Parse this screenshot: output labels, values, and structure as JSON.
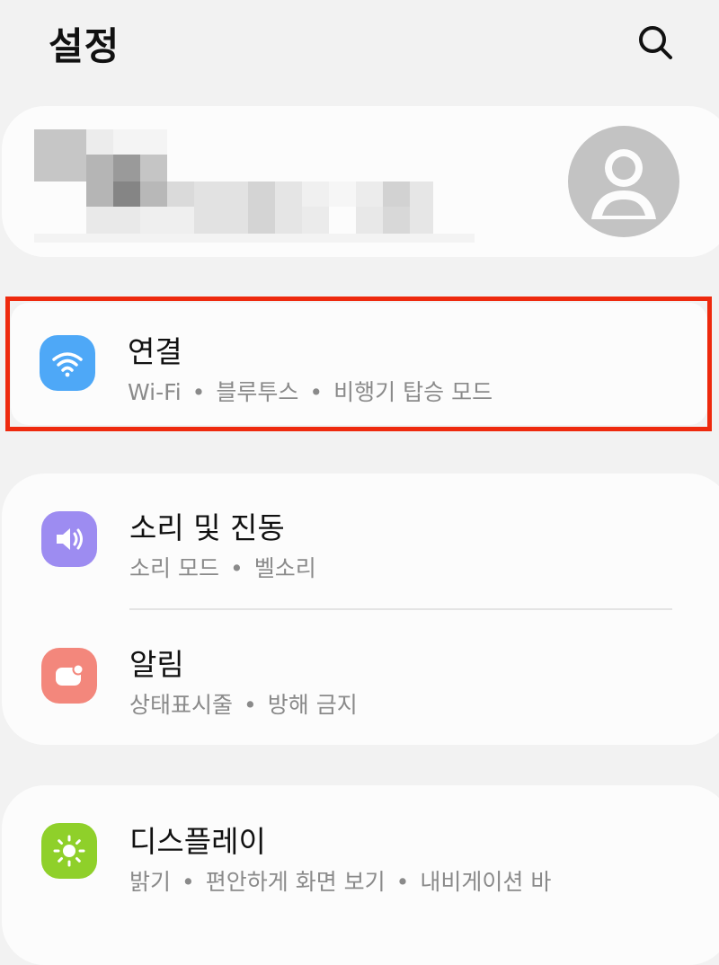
{
  "header": {
    "title": "설정",
    "search_icon": "search-icon"
  },
  "profile": {
    "avatar_icon": "person-avatar-icon"
  },
  "sections": {
    "connections": {
      "title": "연결",
      "sub": [
        "Wi-Fi",
        "블루투스",
        "비행기 탑승 모드"
      ],
      "icon": "wifi-icon",
      "icon_color": "#4ea8f7"
    },
    "sound": {
      "title": "소리 및 진동",
      "sub": [
        "소리 모드",
        "벨소리"
      ],
      "icon": "speaker-icon",
      "icon_color": "#9d8cf1"
    },
    "notifications": {
      "title": "알림",
      "sub": [
        "상태표시줄",
        "방해 금지"
      ],
      "icon": "notification-icon",
      "icon_color": "#f3877c"
    },
    "display": {
      "title": "디스플레이",
      "sub": [
        "밝기",
        "편안하게 화면 보기",
        "내비게이션 바"
      ],
      "icon": "brightness-icon",
      "icon_color": "#8fd02a"
    }
  },
  "colors": {
    "background": "#f2f2f2",
    "card": "#fcfcfc",
    "highlight": "#ee2a0e"
  }
}
